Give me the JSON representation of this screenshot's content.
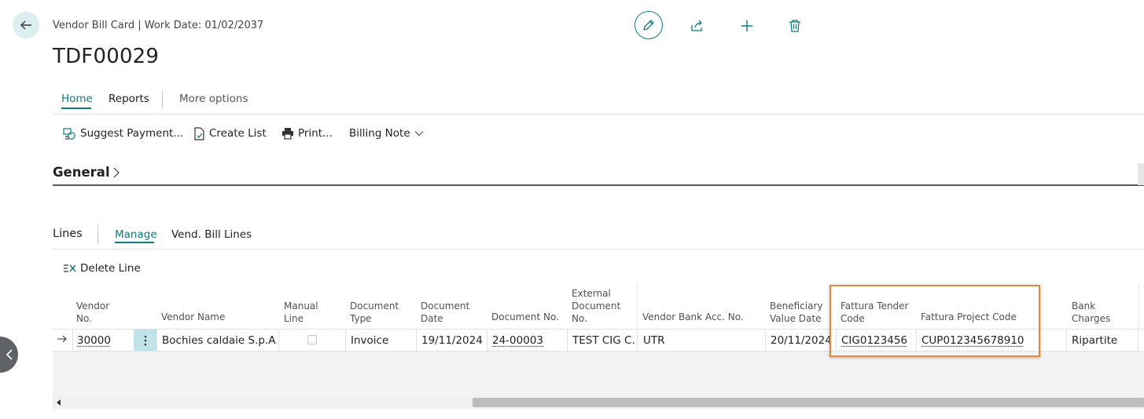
{
  "header": {
    "breadcrumb": "Vendor Bill Card | Work Date: 01/02/2037",
    "title": "TDF00029"
  },
  "top_actions": {
    "icons": [
      "back-arrow-icon",
      "pencil-icon",
      "share-icon",
      "plus-icon",
      "trash-icon"
    ]
  },
  "tabs": [
    {
      "label": "Home"
    },
    {
      "label": "Reports"
    },
    {
      "label": "More options"
    }
  ],
  "actions": [
    {
      "label": "Suggest Payment...",
      "icon": "suggest-payment-icon"
    },
    {
      "label": "Create List",
      "icon": "document-check-icon"
    },
    {
      "label": "Print...",
      "icon": "printer-icon"
    },
    {
      "label": "Billing Note",
      "icon": "chevron-down-icon"
    }
  ],
  "general": {
    "title": "General"
  },
  "lines": {
    "title": "Lines",
    "tabs": [
      {
        "label": "Manage"
      },
      {
        "label": "Vend. Bill Lines"
      }
    ],
    "delete_label": "Delete Line",
    "columns": {
      "vendor_no": [
        "Vendor",
        "No."
      ],
      "vendor_name": [
        "Vendor Name"
      ],
      "manual_line": [
        "Manual",
        "Line"
      ],
      "document_type": [
        "Document",
        "Type"
      ],
      "document_date": [
        "Document",
        "Date"
      ],
      "document_no": [
        "Document No."
      ],
      "external_doc_no": [
        "External",
        "Document",
        "No."
      ],
      "vendor_bank_acc": [
        "Vendor Bank Acc. No."
      ],
      "beneficiary_value_date": [
        "Beneficiary",
        "Value Date"
      ],
      "tender_code": [
        "Fattura Tender",
        "Code"
      ],
      "project_code": [
        "Fattura Project Code"
      ],
      "bank_charges": [
        "Bank",
        "Charges"
      ]
    },
    "row": {
      "vendor_no": "30000",
      "vendor_name": "Bochies caldaie S.p.A.",
      "manual_line": false,
      "document_type": "Invoice",
      "document_date": "19/11/2024",
      "document_no": "24-00003",
      "external_doc_no": "TEST CIG C...",
      "vendor_bank_acc": "UTR",
      "beneficiary_value_date": "20/11/2024",
      "tender_code": "CIG0123456",
      "project_code": "CUP012345678910",
      "bank_charges": "Ripartite"
    }
  },
  "colors": {
    "accent": "#0f7b80",
    "highlight": "#e8873a"
  }
}
